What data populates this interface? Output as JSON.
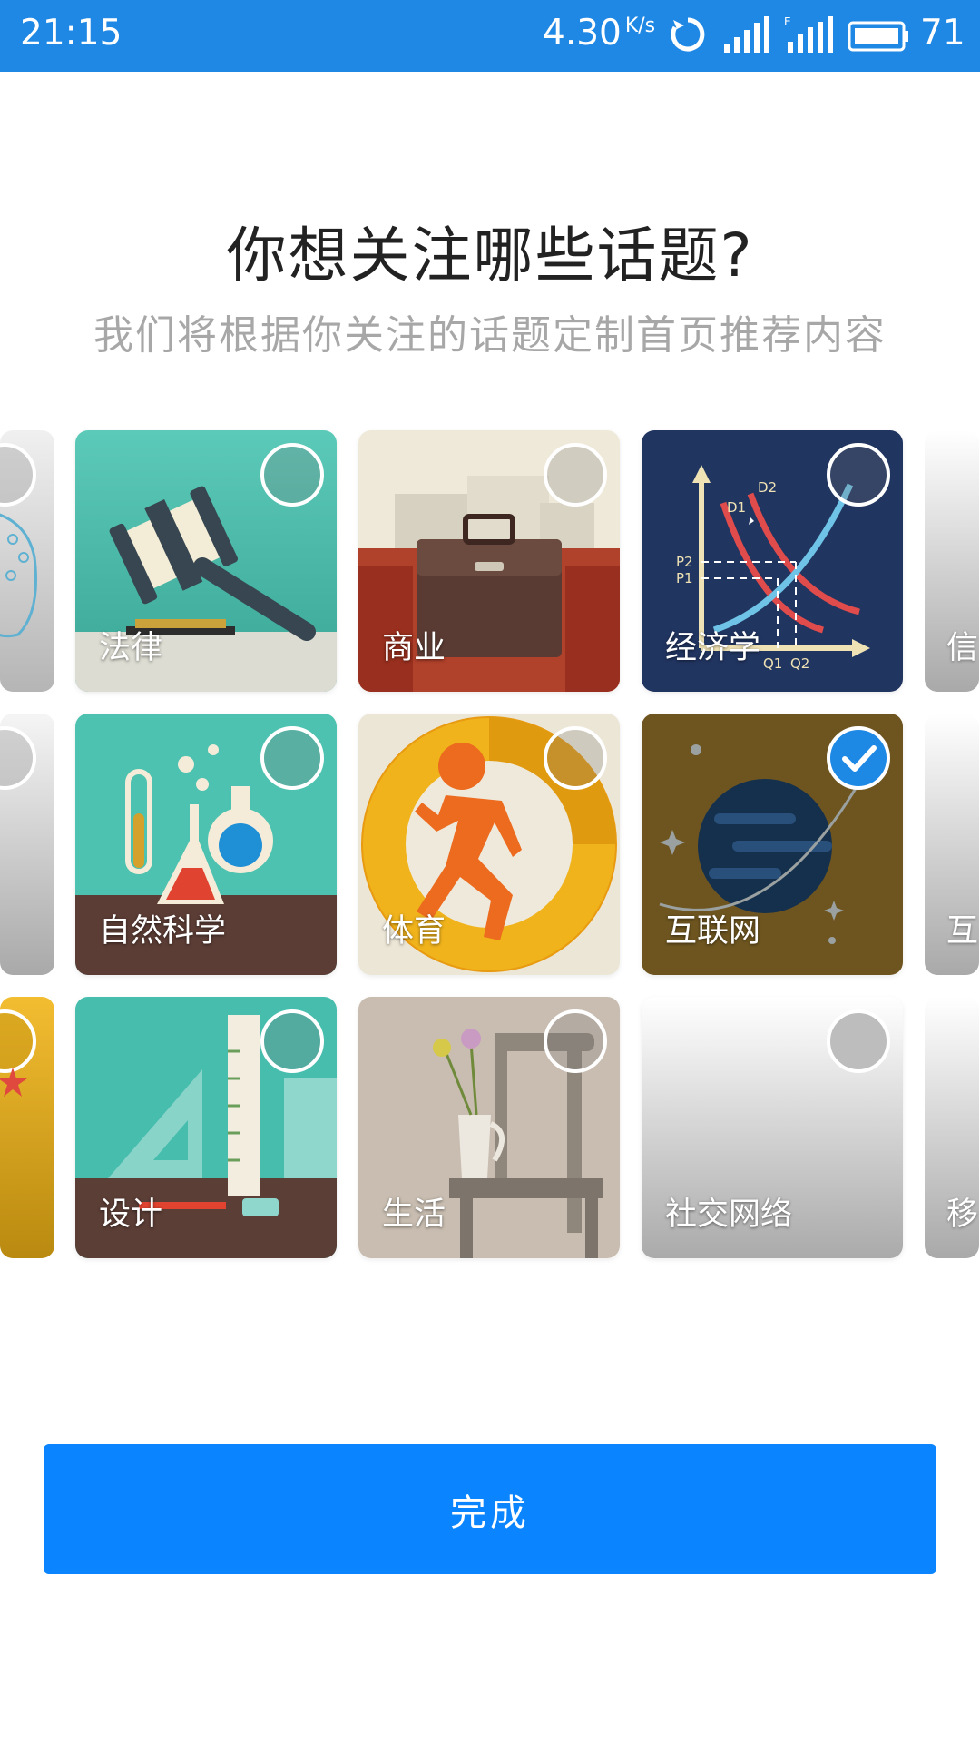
{
  "status_bar": {
    "time": "21:15",
    "network_speed": "4.30",
    "speed_unit": "K/s",
    "battery": "71",
    "icons": [
      "sync-icon",
      "signal-icon",
      "signal-e-icon",
      "battery-icon"
    ]
  },
  "header": {
    "title": "你想关注哪些话题?",
    "subtitle": "我们将根据你关注的话题定制首页推荐内容"
  },
  "topics": [
    {
      "label": "法律",
      "selected": false
    },
    {
      "label": "商业",
      "selected": false
    },
    {
      "label": "经济学",
      "selected": false
    },
    {
      "label": "自然科学",
      "selected": false
    },
    {
      "label": "体育",
      "selected": false
    },
    {
      "label": "互联网",
      "selected": true
    },
    {
      "label": "设计",
      "selected": false
    },
    {
      "label": "生活",
      "selected": false
    },
    {
      "label": "社交网络",
      "selected": false
    }
  ],
  "partial_right_labels": [
    "信",
    "互",
    "移"
  ],
  "chart_labels": {
    "d1": "D1",
    "d2": "D2",
    "p1": "P1",
    "p2": "P2",
    "q1": "Q1",
    "q2": "Q2"
  },
  "footer": {
    "done_label": "完成"
  },
  "colors": {
    "accent": "#1e88e5",
    "status_bar": "#1f88e5",
    "button": "#0a84ff"
  }
}
